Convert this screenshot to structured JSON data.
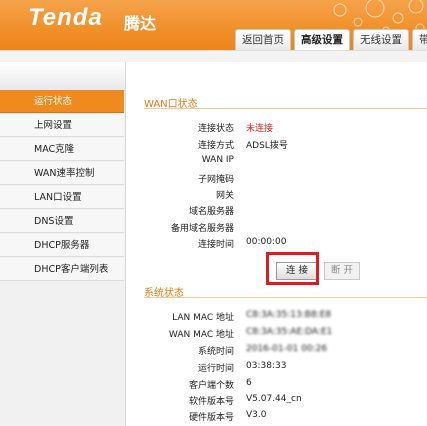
{
  "header": {
    "logo": "Tenda",
    "logo_cn": "腾达",
    "tabs": [
      {
        "label": "返回首页"
      },
      {
        "label": "高级设置"
      },
      {
        "label": "无线设置"
      },
      {
        "label": "带"
      }
    ]
  },
  "sidebar": {
    "items": [
      {
        "label": "运行状态"
      },
      {
        "label": "上网设置"
      },
      {
        "label": "MAC克隆"
      },
      {
        "label": "WAN速率控制"
      },
      {
        "label": "LAN口设置"
      },
      {
        "label": "DNS设置"
      },
      {
        "label": "DHCP服务器"
      },
      {
        "label": "DHCP客户端列表"
      }
    ]
  },
  "wan": {
    "title": "WAN口状态",
    "rows": [
      {
        "label": "连接状态",
        "value": "未连接"
      },
      {
        "label": "连接方式",
        "value": "ADSL拨号"
      },
      {
        "label": "WAN IP",
        "value": ""
      },
      {
        "label": "子网掩码",
        "value": ""
      },
      {
        "label": "网关",
        "value": ""
      },
      {
        "label": "域名服务器",
        "value": ""
      },
      {
        "label": "备用域名服务器",
        "value": ""
      },
      {
        "label": "连接时间",
        "value": "00:00:00"
      }
    ],
    "connect_label": "连 接",
    "disconnect_label": "断 开"
  },
  "system": {
    "title": "系统状态",
    "rows": [
      {
        "label": "LAN MAC 地址",
        "value": "C8:3A:35:13:B8:E8"
      },
      {
        "label": "WAN MAC 地址",
        "value": "C8:3A:35:AE:DA:E1"
      },
      {
        "label": "系统时间",
        "value": "2016-01-01 00:26"
      },
      {
        "label": "运行时间",
        "value": "03:38:33"
      },
      {
        "label": "客户端个数",
        "value": "6"
      },
      {
        "label": "软件版本号",
        "value": "V5.07.44_cn"
      },
      {
        "label": "硬件版本号",
        "value": "V3.0"
      }
    ]
  },
  "colors": {
    "accent": "#f08a1e",
    "status_red": "#e02020",
    "highlight_box": "#e01b1b"
  }
}
